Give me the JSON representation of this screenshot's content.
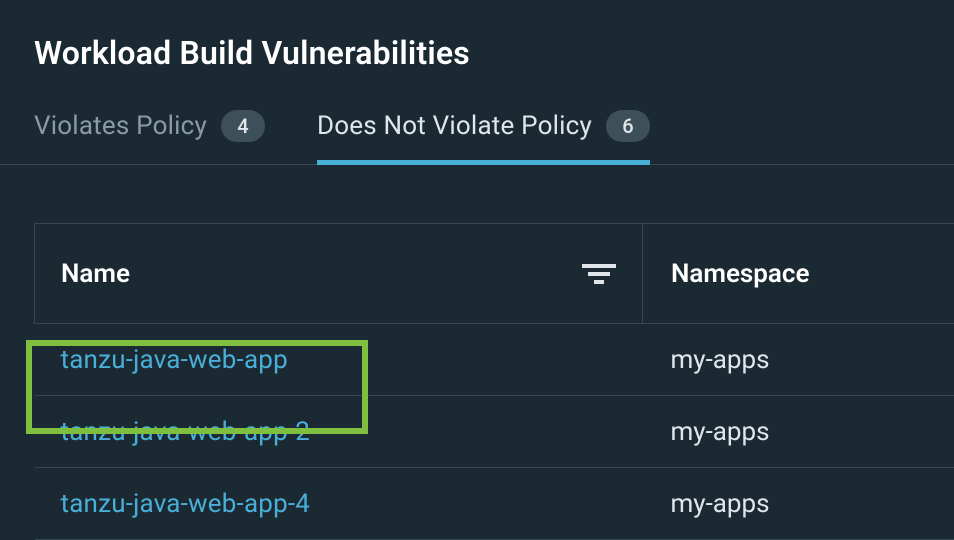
{
  "page": {
    "title": "Workload Build Vulnerabilities"
  },
  "tabs": {
    "violates": {
      "label": "Violates Policy",
      "count": "4"
    },
    "not_violates": {
      "label": "Does Not Violate Policy",
      "count": "6"
    }
  },
  "table": {
    "headers": {
      "name": "Name",
      "namespace": "Namespace"
    },
    "rows": [
      {
        "name": "tanzu-java-web-app",
        "namespace": "my-apps"
      },
      {
        "name": "tanzu-java-web-app-2",
        "namespace": "my-apps"
      },
      {
        "name": "tanzu-java-web-app-4",
        "namespace": "my-apps"
      }
    ]
  }
}
